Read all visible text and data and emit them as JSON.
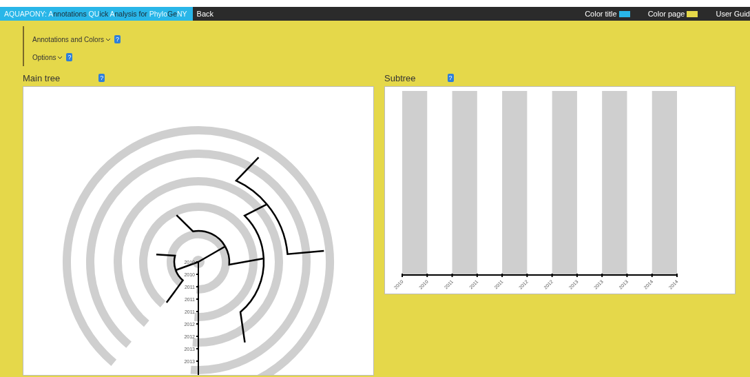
{
  "topbar": {
    "title_segments": [
      {
        "text": "AQUAPONY: A",
        "highlight": true
      },
      {
        "text": "nnotations ",
        "highlight": false
      },
      {
        "text": "QU",
        "highlight": true
      },
      {
        "text": "ick ",
        "highlight": false
      },
      {
        "text": "A",
        "highlight": true
      },
      {
        "text": "nalysis for ",
        "highlight": false
      },
      {
        "text": "Phylo",
        "highlight": true
      },
      {
        "text": "Ge",
        "highlight": false
      },
      {
        "text": "NY",
        "highlight": true
      }
    ],
    "back": "Back",
    "color_controls": [
      {
        "label": "Color title",
        "color": "#29b6e8"
      },
      {
        "label": "Color page",
        "color": "#e5d84a"
      }
    ],
    "guide": "User Guid"
  },
  "menu": [
    {
      "label": "Annotations and Colors",
      "expanded": false,
      "help": "?"
    },
    {
      "label": "Options",
      "expanded": false,
      "help": "?"
    }
  ],
  "main_tree": {
    "title": "Main tree",
    "help": "?",
    "axis_labels": [
      "2010",
      "2010",
      "2011",
      "2011",
      "2011",
      "2012",
      "2012",
      "2013",
      "2013"
    ]
  },
  "subtree": {
    "title": "Subtree",
    "help": "?",
    "axis_labels": [
      "2010",
      "2010",
      "2011",
      "2011",
      "2011",
      "2012",
      "2012",
      "2013",
      "2013",
      "2013",
      "2014",
      "2014"
    ]
  }
}
